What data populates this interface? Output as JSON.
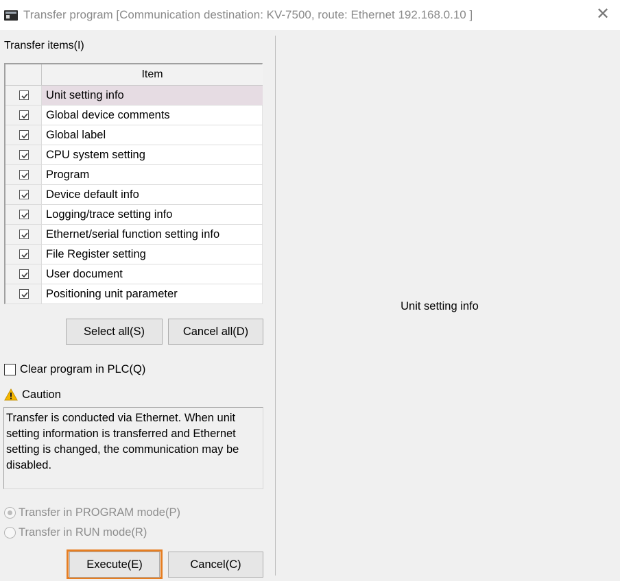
{
  "window": {
    "title": "Transfer program [Communication destination: KV-7500, route: Ethernet  192.168.0.10 ]",
    "close_glyph": "✕"
  },
  "transfer_items": {
    "label": "Transfer items(I)",
    "column_header": "Item",
    "rows": [
      {
        "label": "Unit setting info",
        "checked": true,
        "selected": true
      },
      {
        "label": "Global device comments",
        "checked": true
      },
      {
        "label": "Global label",
        "checked": true
      },
      {
        "label": "CPU system setting",
        "checked": true
      },
      {
        "label": "Program",
        "checked": true
      },
      {
        "label": "Device default info",
        "checked": true
      },
      {
        "label": "Logging/trace setting info",
        "checked": true
      },
      {
        "label": "Ethernet/serial function setting info",
        "checked": true
      },
      {
        "label": "File Register setting",
        "checked": true
      },
      {
        "label": "User document",
        "checked": true
      },
      {
        "label": "Positioning unit parameter",
        "checked": true
      }
    ]
  },
  "buttons": {
    "select_all": "Select all(S)",
    "cancel_all": "Cancel all(D)",
    "execute": "Execute(E)",
    "cancel": "Cancel(C)"
  },
  "options": {
    "clear_program_label": "Clear program in PLC(Q)",
    "clear_program_checked": false,
    "radio_program_mode": "Transfer in PROGRAM mode(P)",
    "radio_run_mode": "Transfer in RUN mode(R)",
    "selected_mode": "program"
  },
  "caution": {
    "label": "Caution",
    "text": "Transfer is conducted via Ethernet. When unit setting information is transferred and Ethernet setting is changed, the communication may be disabled."
  },
  "detail_panel": {
    "text": "Unit setting info"
  },
  "icons": {
    "app": "app-icon",
    "close": "close-icon",
    "checkbox": "checkbox-icon",
    "warning": "warning-icon"
  },
  "colors": {
    "highlight_border": "#e67e22",
    "selected_row": "#e6dce3",
    "warning_icon": "#f5b700"
  }
}
